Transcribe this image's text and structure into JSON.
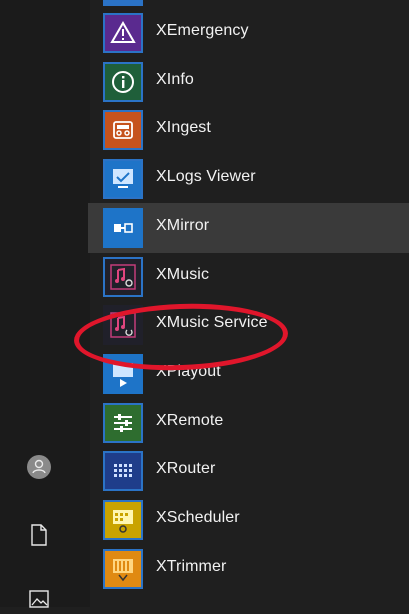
{
  "apps": [
    {
      "label": "XEmergency",
      "icon": "warning-icon",
      "tile": "#5a2a8f",
      "border": "#2b73c6"
    },
    {
      "label": "XInfo",
      "icon": "info-icon",
      "tile": "#1f5f3a",
      "border": "#2b73c6"
    },
    {
      "label": "XIngest",
      "icon": "cassette-icon",
      "tile": "#c6531d",
      "border": "#2b73c6"
    },
    {
      "label": "XLogs Viewer",
      "icon": "monitor-check-icon",
      "tile": "#1e74c8",
      "border": "#2b73c6"
    },
    {
      "label": "XMirror",
      "icon": "mirror-icon",
      "tile": "#1e74c8",
      "border": "#1e74c8"
    },
    {
      "label": "XMusic",
      "icon": "music-note-icon",
      "tile": "#20202a",
      "border": "#2b73c6"
    },
    {
      "label": "XMusic Service",
      "icon": "music-service-icon",
      "tile": "#20202a",
      "border": "#20202a"
    },
    {
      "label": "XPlayout",
      "icon": "playout-icon",
      "tile": "#1e74c8",
      "border": "#1e74c8"
    },
    {
      "label": "XRemote",
      "icon": "sliders-icon",
      "tile": "#2e6d2f",
      "border": "#2b73c6"
    },
    {
      "label": "XRouter",
      "icon": "router-grid-icon",
      "tile": "#1f3d8a",
      "border": "#2b73c6"
    },
    {
      "label": "XScheduler",
      "icon": "scheduler-icon",
      "tile": "#c9a300",
      "border": "#2b73c6"
    },
    {
      "label": "XTrimmer",
      "icon": "trimmer-icon",
      "tile": "#e08a12",
      "border": "#2b73c6"
    }
  ],
  "colors": {
    "highlight_ring": "#e0162b",
    "hover_row": "#3a3a3a"
  },
  "rail": [
    {
      "icon": "user-avatar-icon"
    },
    {
      "icon": "document-icon"
    },
    {
      "icon": "pictures-icon"
    }
  ]
}
